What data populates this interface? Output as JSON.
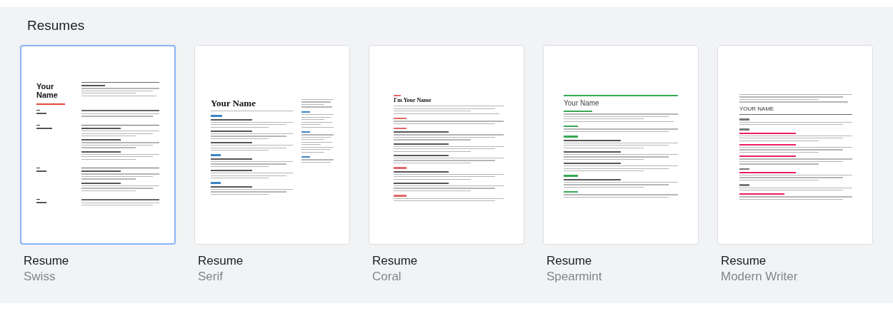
{
  "gallery": {
    "title": "Resumes",
    "templates": [
      {
        "kind": "swiss",
        "title": "Resume",
        "subtitle": "Swiss",
        "selected": true,
        "color": "#e8453c",
        "preview": {
          "name": "Your Name"
        }
      },
      {
        "kind": "serif",
        "title": "Resume",
        "subtitle": "Serif",
        "selected": false,
        "color": "#3d85c6",
        "preview": {
          "name": "Your Name"
        }
      },
      {
        "kind": "coral",
        "title": "Resume",
        "subtitle": "Coral",
        "selected": false,
        "color": "#e06666",
        "preview": {
          "name": "I'm Your Name"
        }
      },
      {
        "kind": "spearmint",
        "title": "Resume",
        "subtitle": "Spearmint",
        "selected": false,
        "color": "#34a853",
        "preview": {
          "name": "Your Name"
        }
      },
      {
        "kind": "modern",
        "title": "Resume",
        "subtitle": "Modern Writer",
        "selected": false,
        "color": "#e91e63",
        "preview": {
          "name": "YOUR NAME"
        }
      }
    ]
  }
}
